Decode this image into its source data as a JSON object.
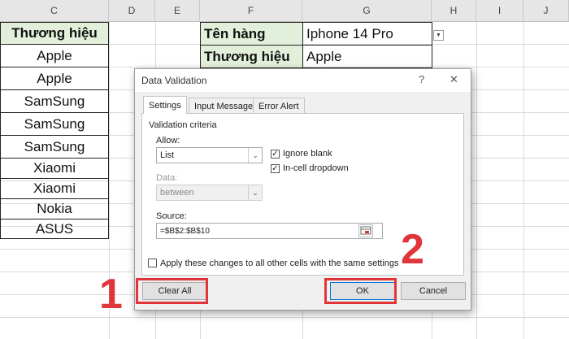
{
  "columns": [
    "C",
    "D",
    "E",
    "F",
    "G",
    "H",
    "I",
    "J"
  ],
  "brand_column": {
    "header": "Thương hiệu",
    "values": [
      "Apple",
      "Apple",
      "SamSung",
      "SamSung",
      "SamSung",
      "Xiaomi",
      "Xiaomi",
      "Nokia",
      "ASUS"
    ]
  },
  "info_table": {
    "row1_label": "Tên hàng",
    "row1_value": "Iphone 14 Pro",
    "row2_label": "Thương hiệu",
    "row2_value": "Apple"
  },
  "dialog": {
    "title": "Data Validation",
    "help_glyph": "?",
    "close_glyph": "✕",
    "tabs": [
      "Settings",
      "Input Message",
      "Error Alert"
    ],
    "criteria_label": "Validation criteria",
    "allow_label": "Allow:",
    "allow_value": "List",
    "ignore_blank_label": "Ignore blank",
    "incell_dropdown_label": "In-cell dropdown",
    "data_label": "Data:",
    "data_value": "between",
    "source_label": "Source:",
    "source_value": "=$B$2:$B$10",
    "apply_all_label": "Apply these changes to all other cells with the same settings",
    "clear_all_label": "Clear All",
    "ok_label": "OK",
    "cancel_label": "Cancel"
  },
  "annotations": {
    "step1": "1",
    "step2": "2"
  },
  "colors": {
    "header_green": "#e2efda",
    "annotation_red": "#e0353b",
    "ok_border": "#0078d7"
  }
}
